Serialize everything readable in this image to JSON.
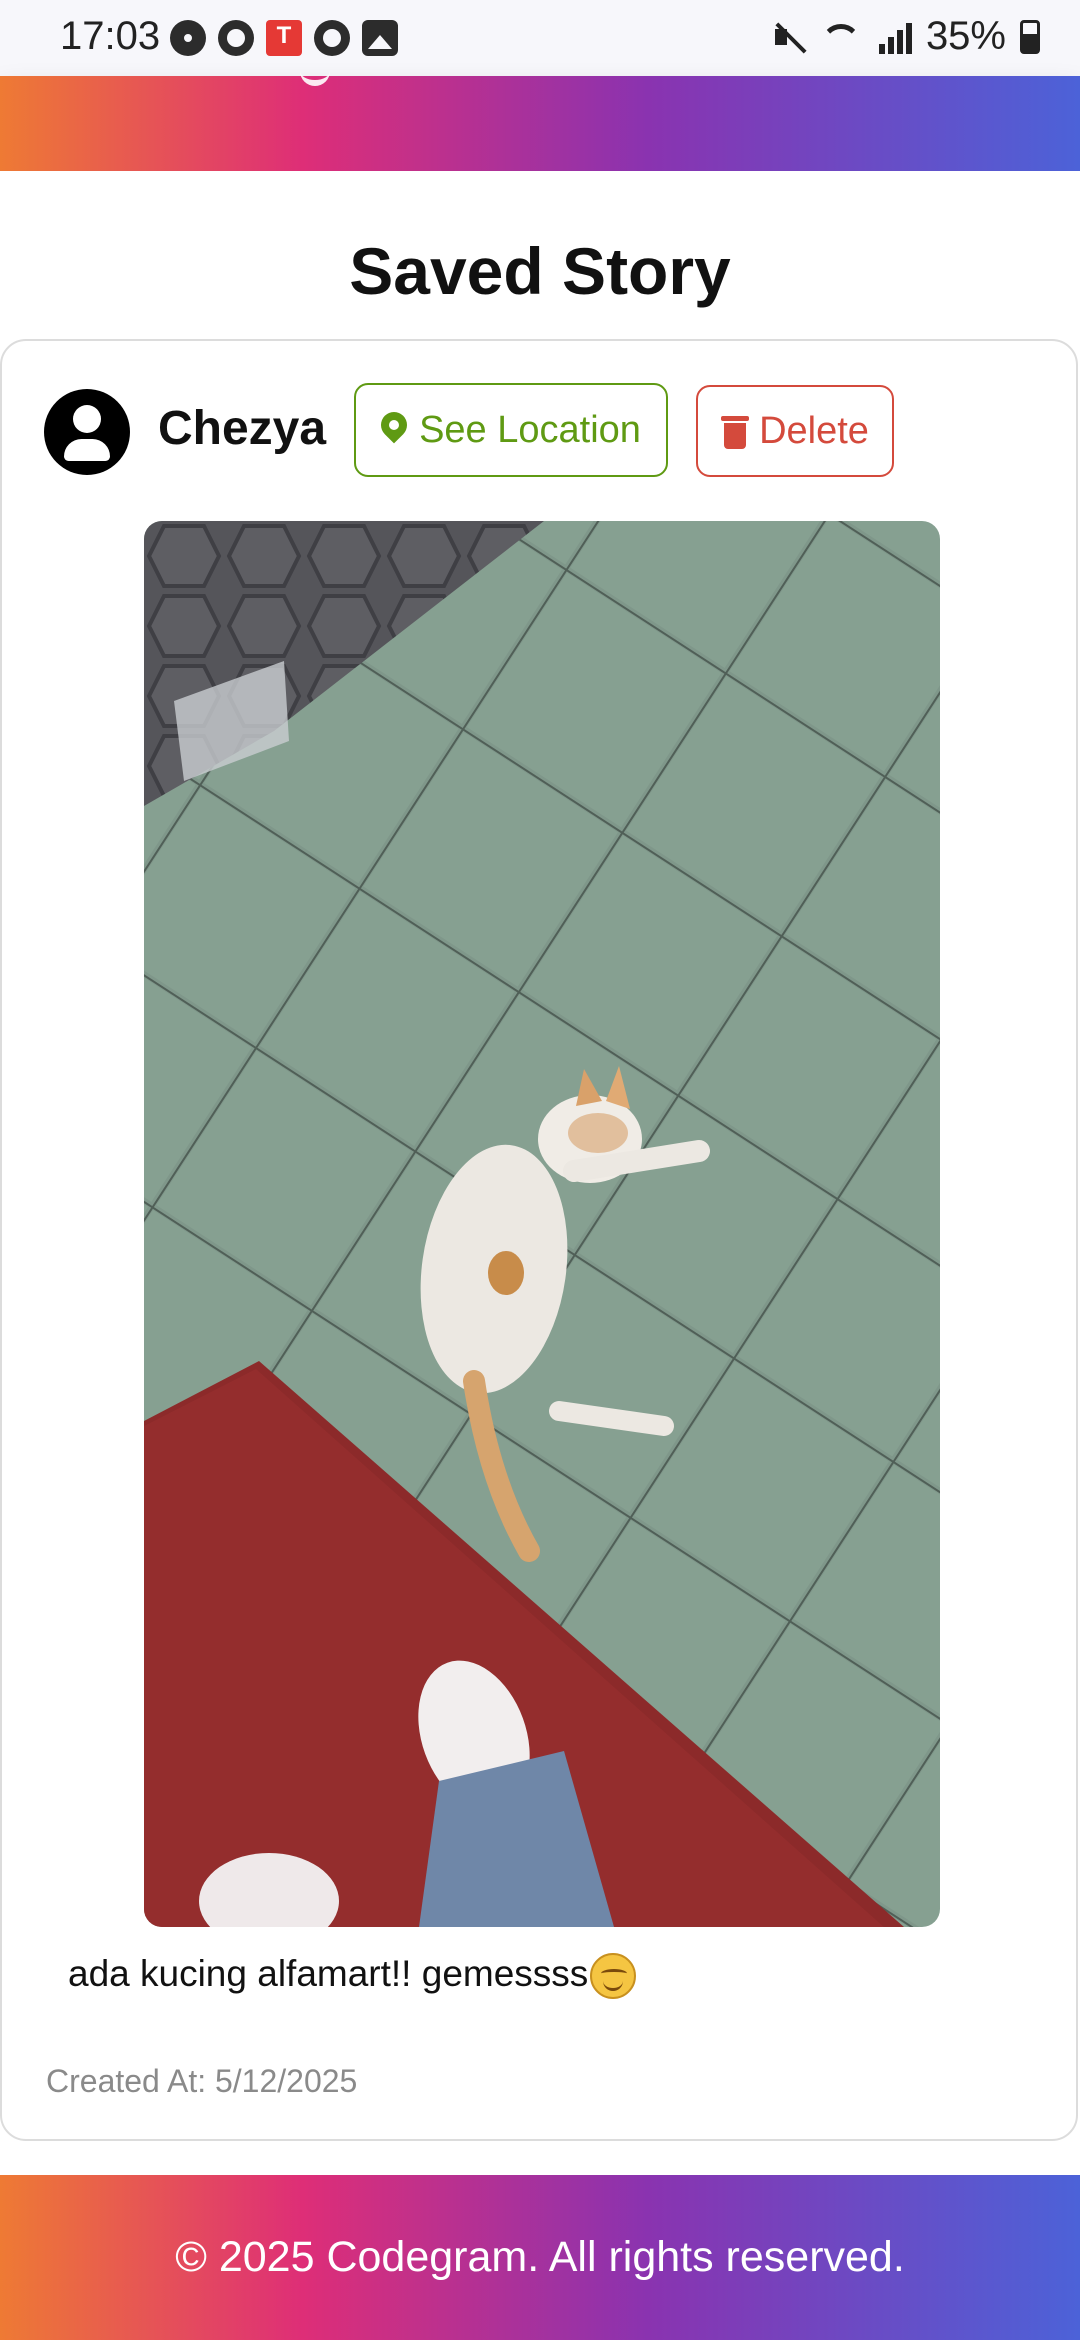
{
  "status_bar": {
    "time": "17:03",
    "battery": "35%",
    "icons": [
      "chrome-icon",
      "github-icon",
      "notification-app-icon",
      "github-icon",
      "gallery-icon",
      "mute-icon",
      "wifi-icon",
      "signal-icon",
      "battery-icon"
    ]
  },
  "page": {
    "title": "Saved Story"
  },
  "story": {
    "username": "Chezya",
    "location_button": "See Location",
    "delete_button": "Delete",
    "caption": "ada kucing alfamart!! gemessss",
    "created_at": "Created At: 5/12/2025"
  },
  "footer": {
    "text": "© 2025 Codegram. All rights reserved."
  },
  "colors": {
    "gradient_start": "#ee7a34",
    "gradient_mid": "#de2e77",
    "gradient_end": "#4c62d8",
    "location_green": "#5f9a13",
    "delete_red": "#d44a3c"
  }
}
